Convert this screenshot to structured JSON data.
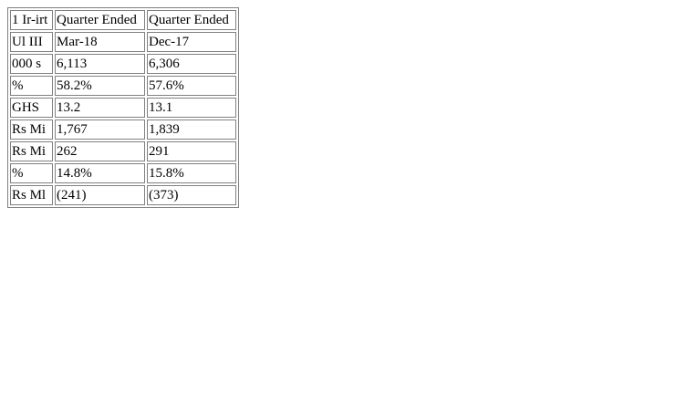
{
  "table": {
    "rows": [
      [
        "1 Ir-irt",
        "Quarter Ended",
        "Quarter Ended"
      ],
      [
        "Ul III",
        "Mar-18",
        "Dec-17"
      ],
      [
        "000 s",
        "6,113",
        "6,306"
      ],
      [
        "%",
        "58.2%",
        "57.6%"
      ],
      [
        "GHS",
        "13.2",
        "13.1"
      ],
      [
        "Rs Mi",
        "1,767",
        "1,839"
      ],
      [
        "Rs Mi",
        "262",
        "291"
      ],
      [
        "%",
        "14.8%",
        "15.8%"
      ],
      [
        "Rs Ml",
        "(241)",
        "(373)"
      ]
    ]
  }
}
